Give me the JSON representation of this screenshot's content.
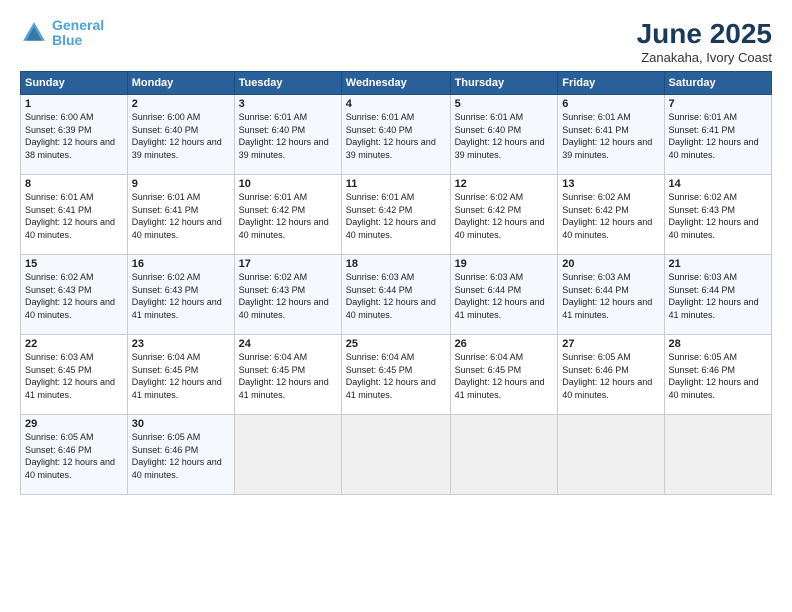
{
  "header": {
    "logo_line1": "General",
    "logo_line2": "Blue",
    "month": "June 2025",
    "location": "Zanakaha, Ivory Coast"
  },
  "weekdays": [
    "Sunday",
    "Monday",
    "Tuesday",
    "Wednesday",
    "Thursday",
    "Friday",
    "Saturday"
  ],
  "weeks": [
    [
      {
        "day": "1",
        "sunrise": "6:00 AM",
        "sunset": "6:39 PM",
        "daylight": "12 hours and 38 minutes."
      },
      {
        "day": "2",
        "sunrise": "6:00 AM",
        "sunset": "6:40 PM",
        "daylight": "12 hours and 39 minutes."
      },
      {
        "day": "3",
        "sunrise": "6:01 AM",
        "sunset": "6:40 PM",
        "daylight": "12 hours and 39 minutes."
      },
      {
        "day": "4",
        "sunrise": "6:01 AM",
        "sunset": "6:40 PM",
        "daylight": "12 hours and 39 minutes."
      },
      {
        "day": "5",
        "sunrise": "6:01 AM",
        "sunset": "6:40 PM",
        "daylight": "12 hours and 39 minutes."
      },
      {
        "day": "6",
        "sunrise": "6:01 AM",
        "sunset": "6:41 PM",
        "daylight": "12 hours and 39 minutes."
      },
      {
        "day": "7",
        "sunrise": "6:01 AM",
        "sunset": "6:41 PM",
        "daylight": "12 hours and 40 minutes."
      }
    ],
    [
      {
        "day": "8",
        "sunrise": "6:01 AM",
        "sunset": "6:41 PM",
        "daylight": "12 hours and 40 minutes."
      },
      {
        "day": "9",
        "sunrise": "6:01 AM",
        "sunset": "6:41 PM",
        "daylight": "12 hours and 40 minutes."
      },
      {
        "day": "10",
        "sunrise": "6:01 AM",
        "sunset": "6:42 PM",
        "daylight": "12 hours and 40 minutes."
      },
      {
        "day": "11",
        "sunrise": "6:01 AM",
        "sunset": "6:42 PM",
        "daylight": "12 hours and 40 minutes."
      },
      {
        "day": "12",
        "sunrise": "6:02 AM",
        "sunset": "6:42 PM",
        "daylight": "12 hours and 40 minutes."
      },
      {
        "day": "13",
        "sunrise": "6:02 AM",
        "sunset": "6:42 PM",
        "daylight": "12 hours and 40 minutes."
      },
      {
        "day": "14",
        "sunrise": "6:02 AM",
        "sunset": "6:43 PM",
        "daylight": "12 hours and 40 minutes."
      }
    ],
    [
      {
        "day": "15",
        "sunrise": "6:02 AM",
        "sunset": "6:43 PM",
        "daylight": "12 hours and 40 minutes."
      },
      {
        "day": "16",
        "sunrise": "6:02 AM",
        "sunset": "6:43 PM",
        "daylight": "12 hours and 41 minutes."
      },
      {
        "day": "17",
        "sunrise": "6:02 AM",
        "sunset": "6:43 PM",
        "daylight": "12 hours and 40 minutes."
      },
      {
        "day": "18",
        "sunrise": "6:03 AM",
        "sunset": "6:44 PM",
        "daylight": "12 hours and 40 minutes."
      },
      {
        "day": "19",
        "sunrise": "6:03 AM",
        "sunset": "6:44 PM",
        "daylight": "12 hours and 41 minutes."
      },
      {
        "day": "20",
        "sunrise": "6:03 AM",
        "sunset": "6:44 PM",
        "daylight": "12 hours and 41 minutes."
      },
      {
        "day": "21",
        "sunrise": "6:03 AM",
        "sunset": "6:44 PM",
        "daylight": "12 hours and 41 minutes."
      }
    ],
    [
      {
        "day": "22",
        "sunrise": "6:03 AM",
        "sunset": "6:45 PM",
        "daylight": "12 hours and 41 minutes."
      },
      {
        "day": "23",
        "sunrise": "6:04 AM",
        "sunset": "6:45 PM",
        "daylight": "12 hours and 41 minutes."
      },
      {
        "day": "24",
        "sunrise": "6:04 AM",
        "sunset": "6:45 PM",
        "daylight": "12 hours and 41 minutes."
      },
      {
        "day": "25",
        "sunrise": "6:04 AM",
        "sunset": "6:45 PM",
        "daylight": "12 hours and 41 minutes."
      },
      {
        "day": "26",
        "sunrise": "6:04 AM",
        "sunset": "6:45 PM",
        "daylight": "12 hours and 41 minutes."
      },
      {
        "day": "27",
        "sunrise": "6:05 AM",
        "sunset": "6:46 PM",
        "daylight": "12 hours and 40 minutes."
      },
      {
        "day": "28",
        "sunrise": "6:05 AM",
        "sunset": "6:46 PM",
        "daylight": "12 hours and 40 minutes."
      }
    ],
    [
      {
        "day": "29",
        "sunrise": "6:05 AM",
        "sunset": "6:46 PM",
        "daylight": "12 hours and 40 minutes."
      },
      {
        "day": "30",
        "sunrise": "6:05 AM",
        "sunset": "6:46 PM",
        "daylight": "12 hours and 40 minutes."
      },
      null,
      null,
      null,
      null,
      null
    ]
  ]
}
